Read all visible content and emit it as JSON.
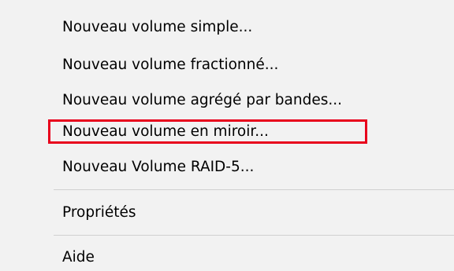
{
  "context_menu": {
    "items": [
      {
        "label": "Nouveau volume simple..."
      },
      {
        "label": "Nouveau volume fractionné..."
      },
      {
        "label": "Nouveau volume agrégé par bandes..."
      },
      {
        "label": "Nouveau volume en miroir...",
        "highlighted": true
      },
      {
        "label": "Nouveau Volume RAID-5..."
      }
    ],
    "properties_label": "Propriétés",
    "help_label": "Aide",
    "highlight_color": "#e8001c",
    "background_color": "#f2f2f2"
  }
}
